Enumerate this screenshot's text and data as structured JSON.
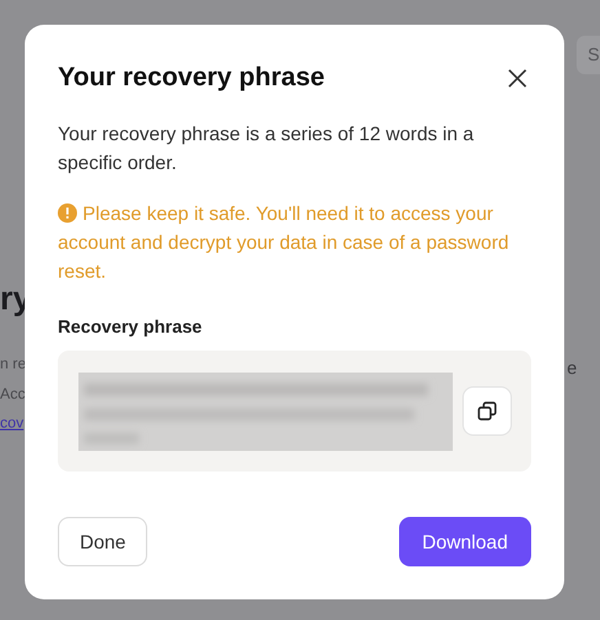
{
  "background": {
    "heading": "ry",
    "lines": [
      "n re",
      "Acc"
    ],
    "link": "cov",
    "right_text": "e",
    "field_text": "S"
  },
  "dialog": {
    "title": "Your recovery phrase",
    "description": "Your recovery phrase is a series of 12 words in a specific order.",
    "warning": "Please keep it safe. You'll need it to access your account and decrypt your data in case of a password reset.",
    "phrase_label": "Recovery phrase",
    "buttons": [
      {
        "label": "Done",
        "kind": "secondary"
      },
      {
        "label": "Download",
        "kind": "primary"
      }
    ]
  }
}
